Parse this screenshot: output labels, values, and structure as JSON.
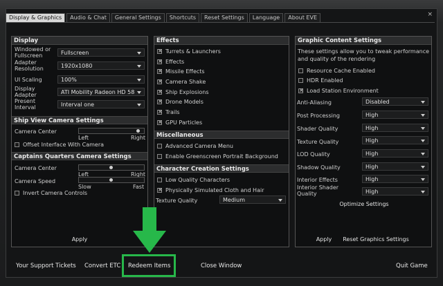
{
  "window": {
    "close_glyph": "×"
  },
  "tabs": [
    {
      "label": "Display & Graphics",
      "active": true
    },
    {
      "label": "Audio & Chat"
    },
    {
      "label": "General Settings"
    },
    {
      "label": "Shortcuts"
    },
    {
      "label": "Reset Settings"
    },
    {
      "label": "Language"
    },
    {
      "label": "About EVE"
    }
  ],
  "display": {
    "title": "Display",
    "windowed_label": "Windowed or Fullscreen",
    "windowed_value": "Fullscreen",
    "resolution_label": "Adapter Resolution",
    "resolution_value": "1920x1080",
    "ui_scaling_label": "UI Scaling",
    "ui_scaling_value": "100%",
    "adapter_label": "Display Adapter",
    "adapter_value": "ATI Mobility Radeon HD 58",
    "present_label": "Present Interval",
    "present_value": "Interval one"
  },
  "ship_view": {
    "title": "Ship View Camera Settings",
    "center_label": "Camera Center",
    "center_level": 0.95,
    "left": "Left",
    "right": "Right",
    "offset_label": "Offset Interface With Camera"
  },
  "captains": {
    "title": "Captains Quarters Camera Settings",
    "center_label": "Camera Center",
    "center_level": 0.5,
    "left": "Left",
    "right": "Right",
    "speed_label": "Camera Speed",
    "speed_level": 0.5,
    "slow": "Slow",
    "fast": "Fast",
    "invert_label": "Invert Camera Controls"
  },
  "apply_left": "Apply",
  "effects": {
    "title": "Effects",
    "items": [
      "Turrets & Launchers",
      "Effects",
      "Missile Effects",
      "Camera Shake",
      "Ship Explosions",
      "Drone Models",
      "Trails",
      "GPU Particles"
    ]
  },
  "misc": {
    "title": "Miscellaneous",
    "items": [
      "Advanced Camera Menu",
      "Enable Greenscreen Portrait Background"
    ]
  },
  "character": {
    "title": "Character Creation Settings",
    "items": [
      "Low Quality Characters",
      "Physically Simulated Cloth and Hair"
    ],
    "texture_label": "Texture Quality",
    "texture_value": "Medium"
  },
  "graphic": {
    "title": "Graphic Content Settings",
    "desc": "These settings allow you to tweak performance and quality of the rendering",
    "checks": [
      "Resource Cache Enabled",
      "HDR Enabled",
      "Load Station Environment"
    ],
    "rows": [
      {
        "label": "Anti-Aliasing",
        "value": "Disabled"
      },
      {
        "label": "Post Processing",
        "value": "High"
      },
      {
        "label": "Shader Quality",
        "value": "High"
      },
      {
        "label": "Texture Quality",
        "value": "High"
      },
      {
        "label": "LOD Quality",
        "value": "High"
      },
      {
        "label": "Shadow Quality",
        "value": "High"
      },
      {
        "label": "Interior Effects",
        "value": "High"
      },
      {
        "label": "Interior Shader Quality",
        "value": "High"
      }
    ],
    "optimize": "Optimize Settings",
    "apply": "Apply",
    "reset": "Reset Graphics Settings"
  },
  "bottom": {
    "support": "Your Support Tickets",
    "convert": "Convert ETC",
    "redeem": "Redeem Items",
    "close": "Close Window",
    "quit": "Quit Game"
  },
  "colors": {
    "highlight": "#27b84a",
    "arrow": "#27b84a",
    "active_tab": "#d8d8d8"
  }
}
